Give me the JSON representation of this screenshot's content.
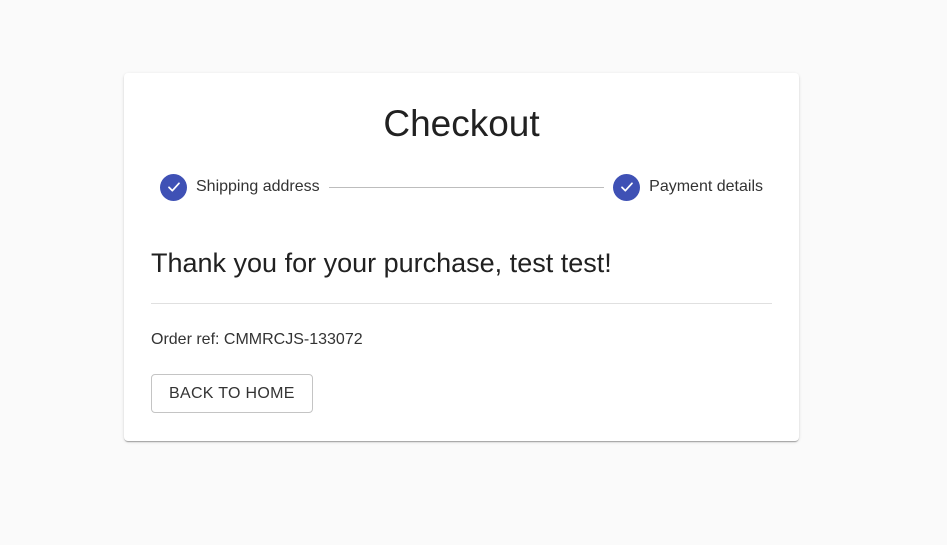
{
  "checkout": {
    "title": "Checkout",
    "steps": [
      {
        "label": "Shipping address",
        "icon": "check-icon",
        "completed": true
      },
      {
        "label": "Payment details",
        "icon": "check-icon",
        "completed": true
      }
    ],
    "thank_you": "Thank you for your purchase, test test!",
    "order_ref": "Order ref: CMMRCJS-133072",
    "back_button_label": "BACK TO HOME"
  },
  "colors": {
    "accent": "#3f51b5",
    "background": "#fafafa",
    "card": "#ffffff"
  }
}
